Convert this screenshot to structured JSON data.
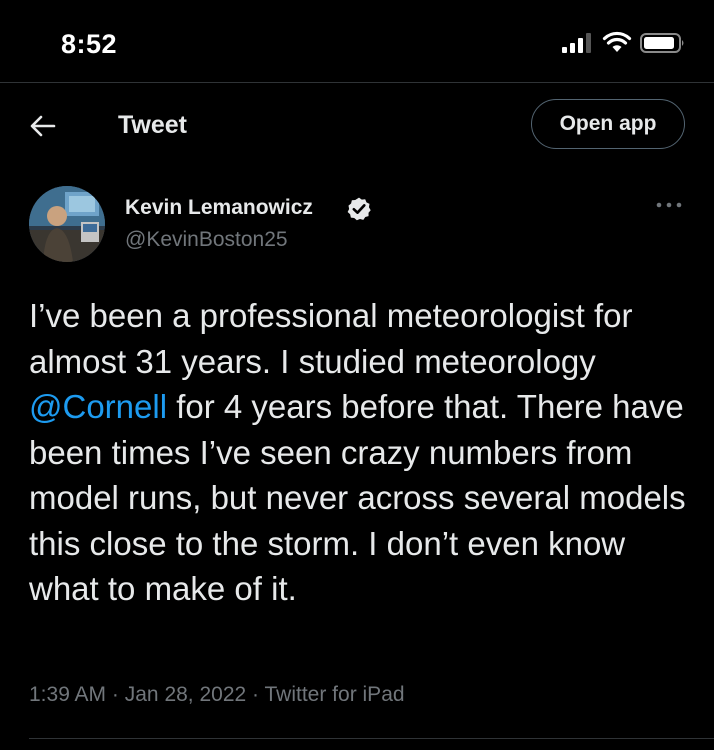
{
  "status_bar": {
    "time": "8:52"
  },
  "nav": {
    "title": "Tweet",
    "open_app_label": "Open app"
  },
  "tweet": {
    "author": {
      "name": "Kevin Lemanowicz",
      "handle": "@KevinBoston25",
      "verified": true
    },
    "text_parts": [
      "I’ve been a professional meteorologist for almost 31 years. I studied meteorology ",
      "@Cornell",
      " for 4 years before that. There have been times I’ve seen crazy numbers from model runs, but never across several models this close to the storm. I don’t even know what to make of it."
    ],
    "meta": {
      "time": "1:39 AM",
      "date": "Jan 28, 2022",
      "source": "Twitter for iPad",
      "separator": "·"
    }
  },
  "colors": {
    "background": "#000000",
    "text": "#e7e9ea",
    "secondary": "#71767b",
    "link": "#1d9bf0",
    "verified": "#e7e9ea"
  },
  "icons": [
    "signal-icon",
    "wifi-icon",
    "battery-icon",
    "back-arrow-icon",
    "verified-badge-icon",
    "more-options-icon"
  ]
}
